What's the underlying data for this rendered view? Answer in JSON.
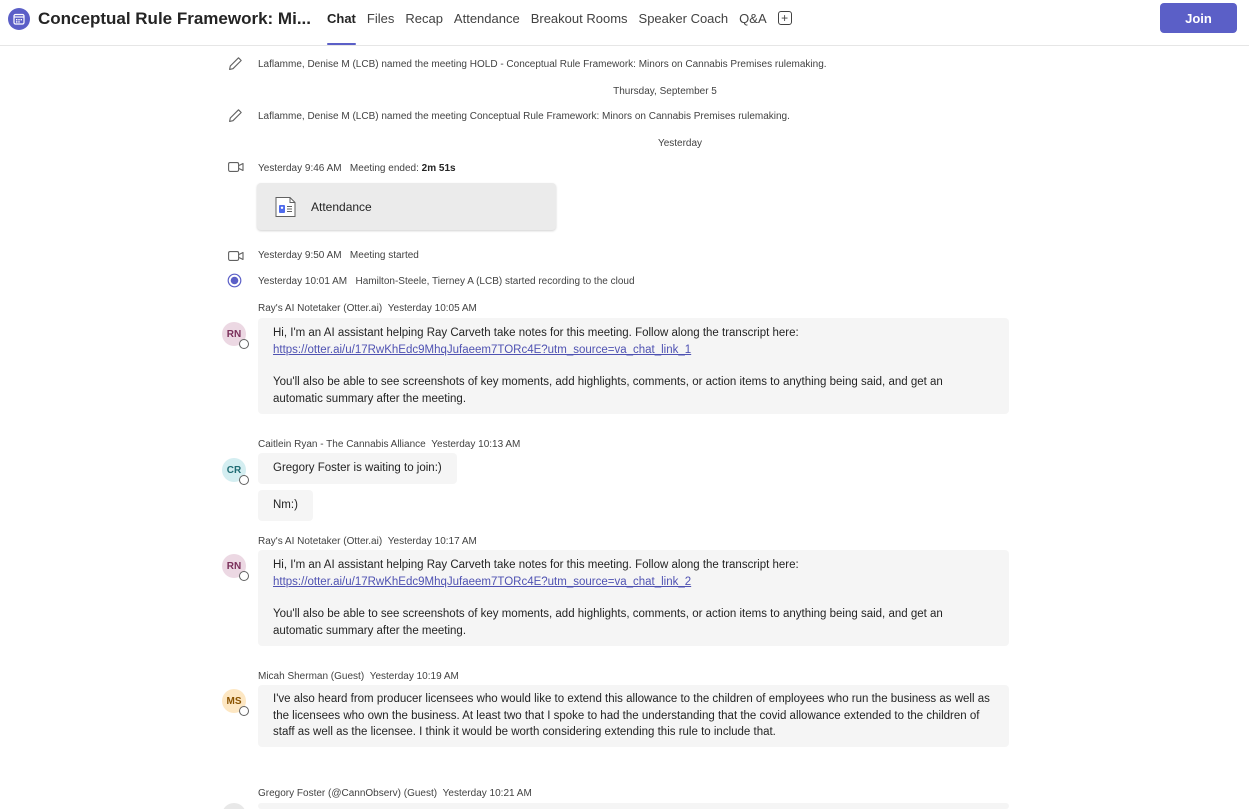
{
  "header": {
    "title": "Conceptual Rule Framework: Mi...",
    "tabs": [
      {
        "label": "Chat",
        "active": true
      },
      {
        "label": "Files"
      },
      {
        "label": "Recap"
      },
      {
        "label": "Attendance"
      },
      {
        "label": "Breakout Rooms"
      },
      {
        "label": "Speaker Coach"
      },
      {
        "label": "Q&A"
      }
    ],
    "join_label": "Join"
  },
  "events": {
    "rename1": "Laflamme, Denise M (LCB) named the meeting HOLD - Conceptual Rule Framework: Minors on Cannabis Premises rulemaking.",
    "date1": "Thursday, September 5",
    "rename2": "Laflamme, Denise M (LCB) named the meeting Conceptual Rule Framework: Minors on Cannabis Premises rulemaking.",
    "date2": "Yesterday",
    "ended_time": "Yesterday 9:46 AM",
    "ended_label": "Meeting ended:",
    "ended_duration": "2m 51s",
    "attendance_card": "Attendance",
    "started_time": "Yesterday 9:50 AM",
    "started_label": "Meeting started",
    "recording_time": "Yesterday 10:01 AM",
    "recording_label": "Hamilton-Steele, Tierney A (LCB) started recording to the cloud"
  },
  "messages": [
    {
      "sender": "Ray's AI Notetaker (Otter.ai)",
      "time": "Yesterday 10:05 AM",
      "initials": "RN",
      "text1": "Hi, I'm an AI assistant helping Ray Carveth take notes for this meeting. Follow along the transcript here:",
      "link": "https://otter.ai/u/17RwKhEdc9MhqJufaeem7TORc4E?utm_source=va_chat_link_1",
      "text2": "You'll also be able to see screenshots of key moments, add highlights, comments, or action items to anything being said, and get an automatic summary after the meeting."
    },
    {
      "sender": "Caitlein Ryan - The Cannabis Alliance",
      "time": "Yesterday 10:13 AM",
      "initials": "CR",
      "text1": "Gregory Foster is waiting to join:)",
      "text2": "Nm:)"
    },
    {
      "sender": "Ray's AI Notetaker (Otter.ai)",
      "time": "Yesterday 10:17 AM",
      "initials": "RN",
      "text1": "Hi, I'm an AI assistant helping Ray Carveth take notes for this meeting. Follow along the transcript here:",
      "link": "https://otter.ai/u/17RwKhEdc9MhqJufaeem7TORc4E?utm_source=va_chat_link_2",
      "text2": "You'll also be able to see screenshots of key moments, add highlights, comments, or action items to anything being said, and get an automatic summary after the meeting."
    },
    {
      "sender": "Micah Sherman (Guest)",
      "time": "Yesterday 10:19 AM",
      "initials": "MS",
      "text1": "I've also heard from producer licensees who would like to extend this allowance to the children of employees who run the business as well as the licensees who own the business. At least two that I spoke to had the understanding that the covid allowance extended to the children of staff as well as the licensee. I think it would be worth considering extending this rule to include that."
    },
    {
      "sender": "Gregory Foster (@CannObserv) (Guest)",
      "time": "Yesterday 10:21 AM"
    }
  ],
  "colors": {
    "accent": "#5b5fc7",
    "rn_avatar_bg": "#ecd8e3",
    "rn_avatar_fg": "#7a2f5a",
    "cr_avatar_bg": "#d4eef1",
    "cr_avatar_fg": "#1f6b73",
    "ms_avatar_bg": "#fde7c3",
    "ms_avatar_fg": "#8a5300"
  }
}
